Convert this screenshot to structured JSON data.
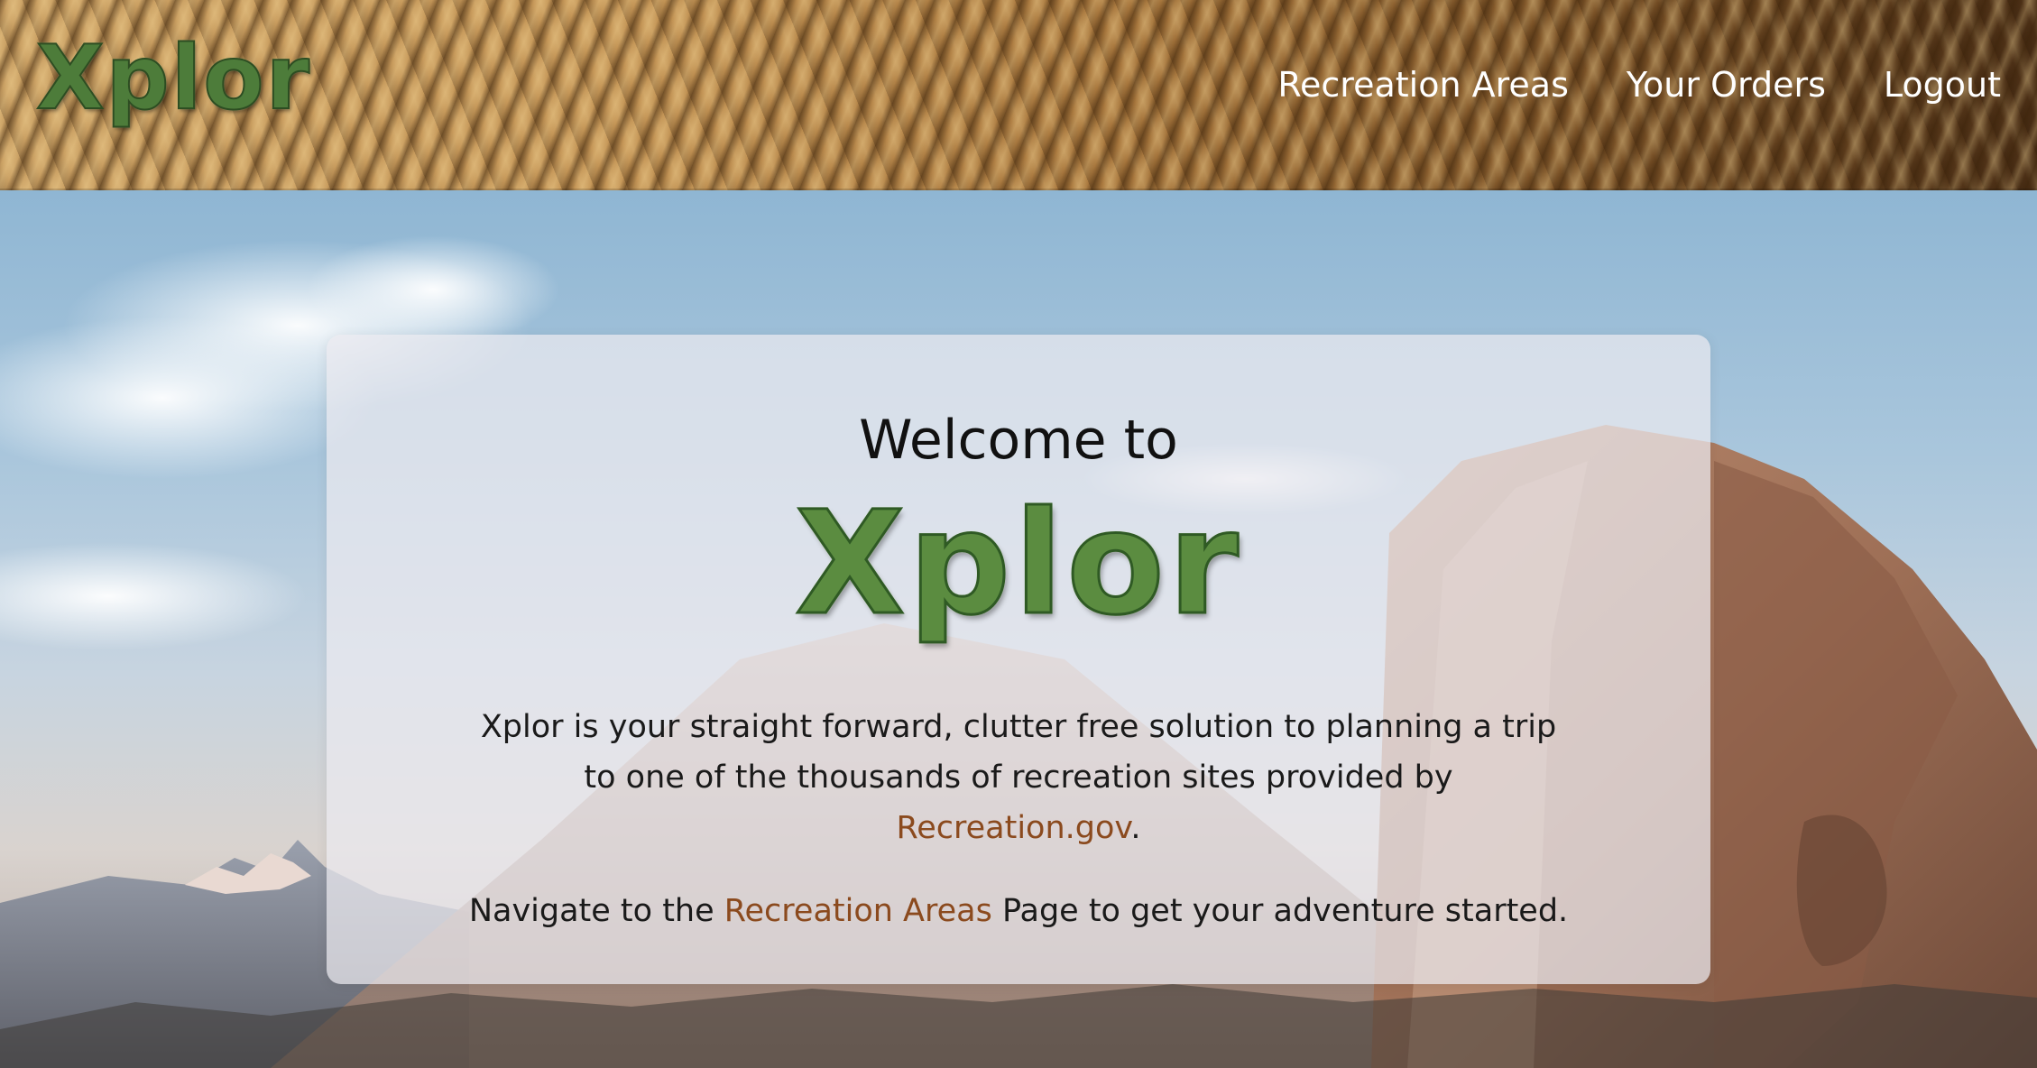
{
  "header": {
    "logo": "Xplor",
    "nav": [
      {
        "label": "Recreation Areas"
      },
      {
        "label": "Your Orders"
      },
      {
        "label": "Logout"
      }
    ]
  },
  "welcome": {
    "heading": "Welcome to",
    "logo": "Xplor",
    "paragraph1": {
      "before": "Xplor is your straight forward, clutter free solution to planning a trip to one of the thousands of recreation sites provided by ",
      "link": "Recreation.gov",
      "after": "."
    },
    "paragraph2": {
      "before": "Navigate to the ",
      "link": "Recreation Areas",
      "after": " Page to get your adventure started."
    }
  },
  "colors": {
    "link": "#8b4a1e",
    "nav_text": "#ffffff",
    "logo_green": "#5b8c40"
  },
  "icons": {
    "header_background": "sand-dunes-texture",
    "page_background": "mountain-landscape-photo"
  }
}
